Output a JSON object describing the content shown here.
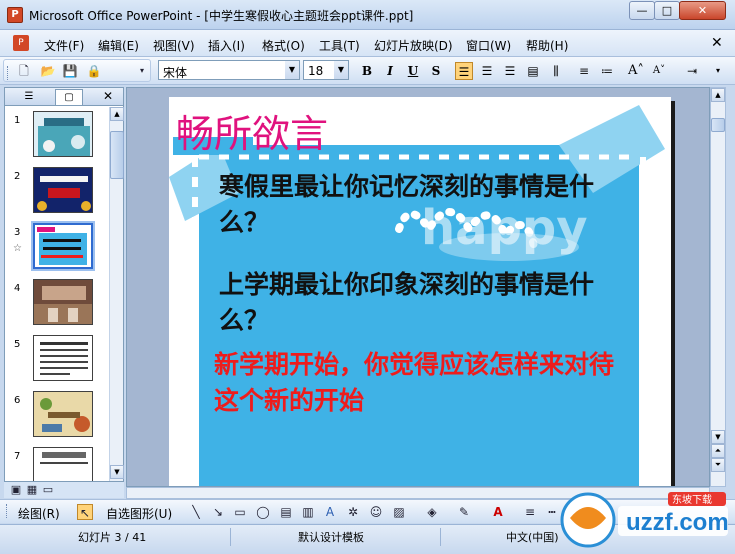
{
  "window": {
    "title": "Microsoft Office PowerPoint - [中学生寒假收心主题班会ppt课件.ppt]",
    "icon": "powerpoint-icon",
    "minimize": "—",
    "maximize": "□",
    "close": "✕"
  },
  "menu": {
    "items": [
      "文件(F)",
      "编辑(E)",
      "视图(V)",
      "插入(I)",
      "格式(O)",
      "工具(T)",
      "幻灯片放映(D)",
      "窗口(W)",
      "帮助(H)"
    ],
    "close": "✕"
  },
  "toolbar": {
    "font_name": "宋体",
    "font_size": "18",
    "bold": "B",
    "italic": "I",
    "underline": "U",
    "shadow": "S"
  },
  "left_pane": {
    "close": "✕",
    "slides": [
      {
        "number": "1"
      },
      {
        "number": "2"
      },
      {
        "number": "3"
      },
      {
        "number": "4"
      },
      {
        "number": "5"
      },
      {
        "number": "6"
      },
      {
        "number": "7"
      }
    ],
    "selected_index": 3
  },
  "slide": {
    "title": "畅所欲言",
    "question1": "寒假里最让你记忆深刻的事情是什么？",
    "question2": "上学期最让你印象深刻的事情是什么？",
    "question3": "新学期开始，你觉得应该怎样来对待这个新的开始",
    "decoration_text": "happy"
  },
  "drawbar": {
    "draw_label": "绘图(R)",
    "autoshapes_label": "自选图形(U)"
  },
  "statusbar": {
    "slide_position": "幻灯片 3 / 41",
    "template": "默认设计模板",
    "language": "中文(中国)"
  },
  "watermark": {
    "brand": "uzzf.com",
    "tagline": "东坡下载"
  },
  "colors": {
    "title_pink": "#e0127e",
    "question_red": "#ee1c1c",
    "panel_blue": "#3fb2e6"
  }
}
